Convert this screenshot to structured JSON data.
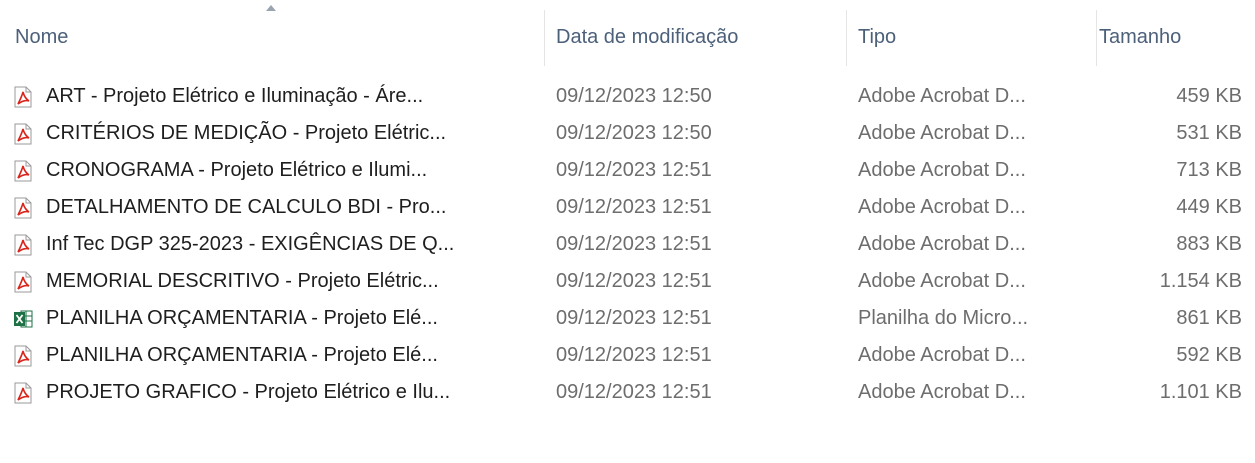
{
  "columns": {
    "name": "Nome",
    "date": "Data de modificação",
    "type": "Tipo",
    "size": "Tamanho"
  },
  "files": [
    {
      "name": "ART - Projeto Elétrico e Iluminação - Áre...",
      "date": "09/12/2023 12:50",
      "type": "Adobe Acrobat D...",
      "size": "459 KB",
      "icon": "pdf-icon"
    },
    {
      "name": "CRITÉRIOS DE MEDIÇÃO - Projeto Elétric...",
      "date": "09/12/2023 12:50",
      "type": "Adobe Acrobat D...",
      "size": "531 KB",
      "icon": "pdf-icon"
    },
    {
      "name": "CRONOGRAMA - Projeto Elétrico e Ilumi...",
      "date": "09/12/2023 12:51",
      "type": "Adobe Acrobat D...",
      "size": "713 KB",
      "icon": "pdf-icon"
    },
    {
      "name": "DETALHAMENTO DE CALCULO BDI - Pro...",
      "date": "09/12/2023 12:51",
      "type": "Adobe Acrobat D...",
      "size": "449 KB",
      "icon": "pdf-icon"
    },
    {
      "name": "Inf Tec DGP 325-2023 - EXIGÊNCIAS DE Q...",
      "date": "09/12/2023 12:51",
      "type": "Adobe Acrobat D...",
      "size": "883 KB",
      "icon": "pdf-icon"
    },
    {
      "name": "MEMORIAL DESCRITIVO - Projeto Elétric...",
      "date": "09/12/2023 12:51",
      "type": "Adobe Acrobat D...",
      "size": "1.154 KB",
      "icon": "pdf-icon"
    },
    {
      "name": "PLANILHA ORÇAMENTARIA - Projeto Elé...",
      "date": "09/12/2023 12:51",
      "type": "Planilha do Micro...",
      "size": "861 KB",
      "icon": "excel-icon"
    },
    {
      "name": "PLANILHA ORÇAMENTARIA - Projeto Elé...",
      "date": "09/12/2023 12:51",
      "type": "Adobe Acrobat D...",
      "size": "592 KB",
      "icon": "pdf-icon"
    },
    {
      "name": "PROJETO GRAFICO - Projeto Elétrico e Ilu...",
      "date": "09/12/2023 12:51",
      "type": "Adobe Acrobat D...",
      "size": "1.101 KB",
      "icon": "pdf-icon"
    }
  ],
  "colors": {
    "header_text": "#4c607a",
    "name_text": "#1e1e1e",
    "meta_text": "#6d6d6d",
    "pdf_red": "#d8261c",
    "excel_green": "#1e7145"
  }
}
